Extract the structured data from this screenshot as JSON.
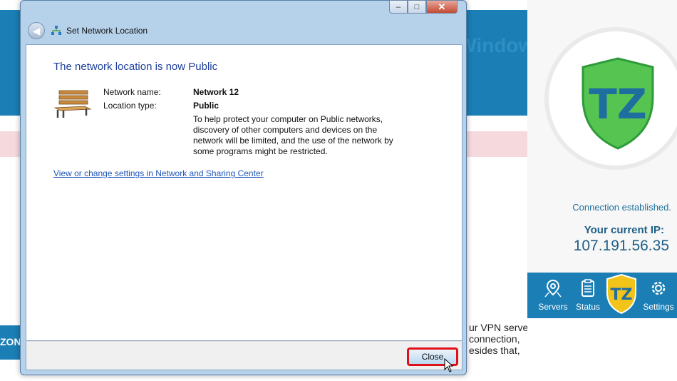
{
  "web": {
    "banner_title": "Trust.Zone VPN client for Windows",
    "text_lines": [
      "ur VPN servers",
      "connection,",
      "esides that,"
    ],
    "side_label": "ZON"
  },
  "vpn": {
    "status": "Connection established.",
    "ip_label": "Your current IP:",
    "ip": "107.191.56.35",
    "nav": [
      {
        "label": "Servers",
        "icon": "map-pin-icon"
      },
      {
        "label": "Status",
        "icon": "clipboard-icon"
      },
      {
        "label": "",
        "icon": "tz-shield-icon"
      },
      {
        "label": "Settings",
        "icon": "gear-icon"
      }
    ],
    "colors": {
      "brand_blue": "#1b7eb4",
      "shield_green": "#56c451",
      "shield_text": "#1f6ea0"
    }
  },
  "dialog": {
    "title": "Set Network Location",
    "heading": "The network location is now Public",
    "fields": [
      {
        "label": "Network name:",
        "value": "Network  12"
      },
      {
        "label": "Location type:",
        "value": "Public"
      }
    ],
    "description": "To help protect your computer on Public networks, discovery of other computers and devices on the network will be limited, and the use of the network by some programs might be restricted.",
    "link": "View or change settings in Network and Sharing Center",
    "close_button": "Close",
    "window_controls": {
      "minimize": "–",
      "maximize": "□",
      "close": "✕"
    },
    "back_glyph": "◀"
  }
}
